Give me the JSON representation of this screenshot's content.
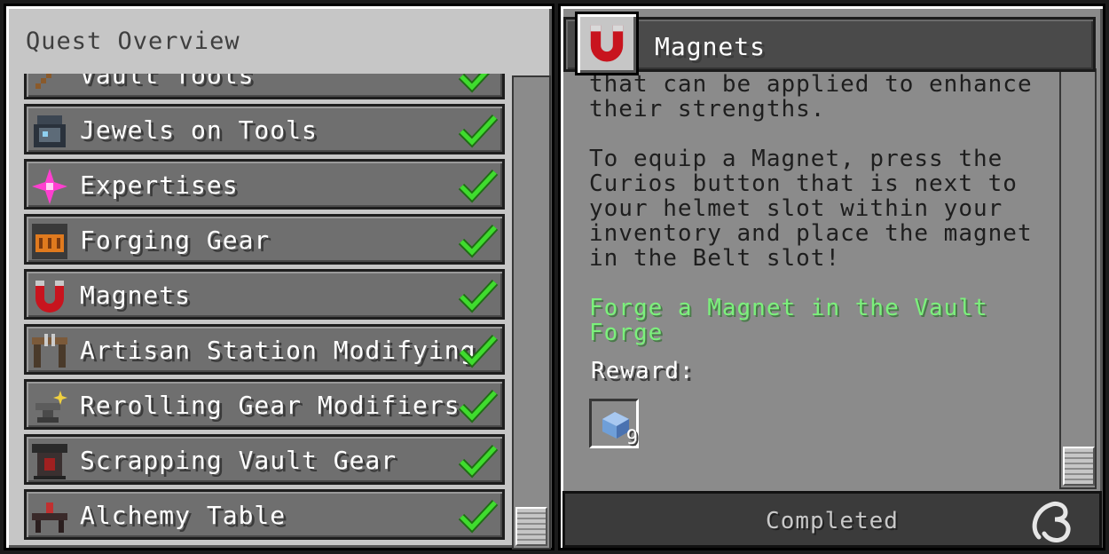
{
  "overview": {
    "title": "Quest Overview"
  },
  "quests": [
    {
      "label": "Vault Tools",
      "icon": "pickaxe-icon",
      "completed": true
    },
    {
      "label": "Jewels on Tools",
      "icon": "jewel-case-icon",
      "completed": true
    },
    {
      "label": "Expertises",
      "icon": "sparkle-star-icon",
      "completed": true
    },
    {
      "label": "Forging Gear",
      "icon": "vault-forge-icon",
      "completed": true
    },
    {
      "label": "Magnets",
      "icon": "magnet-icon",
      "completed": true
    },
    {
      "label": "Artisan Station Modifying",
      "icon": "artisan-station-icon",
      "completed": true
    },
    {
      "label": "Rerolling Gear Modifiers",
      "icon": "anvil-sparkle-icon",
      "completed": true
    },
    {
      "label": "Scrapping Vault Gear",
      "icon": "recycler-icon",
      "completed": true
    },
    {
      "label": "Alchemy Table",
      "icon": "alchemy-table-icon",
      "completed": true
    }
  ],
  "detail": {
    "title": "Magnets",
    "icon": "magnet-icon",
    "paragraph1": [
      "that can be applied to enhance",
      "their strengths."
    ],
    "paragraph2": [
      "To equip a Magnet, press the",
      "Curios button that is next to",
      "your helmet slot within your",
      "inventory and place the magnet",
      "in the Belt slot!"
    ],
    "goal": [
      "Forge a Magnet in the Vault",
      "Forge"
    ],
    "reward_label": "Reward:",
    "reward_item": {
      "icon": "blue-ingot-icon",
      "count": "9"
    },
    "status": "Completed"
  },
  "colors": {
    "goal_text": "#7cf07c",
    "checkmark": "#3fdc2e",
    "panel_bg": "#c6c6c6",
    "row_bg": "#6f6f6f"
  }
}
